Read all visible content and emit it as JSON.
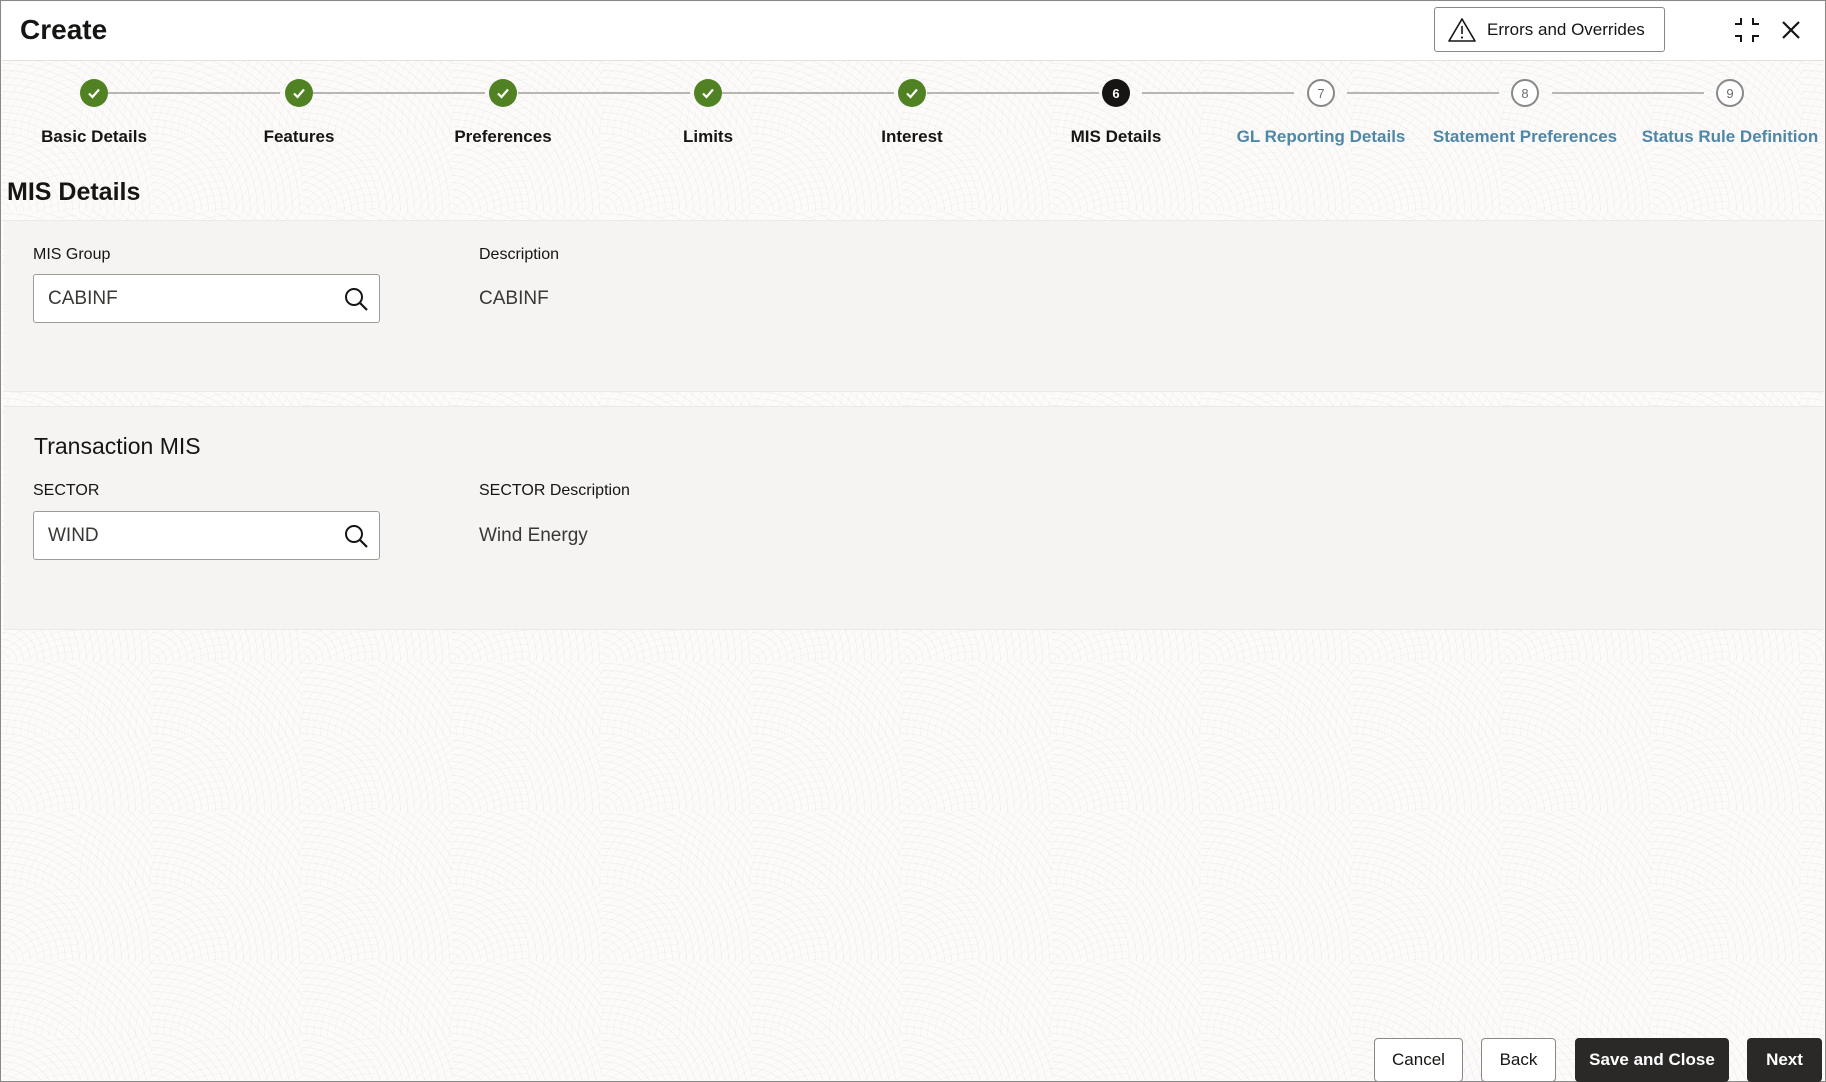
{
  "header": {
    "title": "Create",
    "errors_button": "Errors and Overrides",
    "icons": {
      "minimize": "collapse-icon",
      "close": "close-icon",
      "warning": "warning-icon"
    }
  },
  "train": {
    "stops": [
      {
        "label": "Basic Details",
        "status": "complete",
        "number": ""
      },
      {
        "label": "Features",
        "status": "complete",
        "number": ""
      },
      {
        "label": "Preferences",
        "status": "complete",
        "number": ""
      },
      {
        "label": "Limits",
        "status": "complete",
        "number": ""
      },
      {
        "label": "Interest",
        "status": "complete",
        "number": ""
      },
      {
        "label": "MIS Details",
        "status": "current",
        "number": "6"
      },
      {
        "label": "GL Reporting Details",
        "status": "pending",
        "number": "7"
      },
      {
        "label": "Statement Preferences",
        "status": "pending",
        "number": "8"
      },
      {
        "label": "Status Rule Definition",
        "status": "pending",
        "number": "9"
      }
    ]
  },
  "main": {
    "page_title": "MIS Details",
    "mis_group": {
      "label": "MIS Group",
      "value": "CABINF",
      "description_label": "Description",
      "description_value": "CABINF"
    },
    "transaction_mis": {
      "title": "Transaction MIS",
      "sector_label": "SECTOR",
      "sector_value": "WIND",
      "sector_desc_label": "SECTOR Description",
      "sector_desc_value": "Wind Energy"
    }
  },
  "footer": {
    "cancel": "Cancel",
    "back": "Back",
    "save_close": "Save and Close",
    "next": "Next"
  },
  "colors": {
    "complete": "#508223",
    "current": "#161513",
    "pending_text": "#4e87a7",
    "primary_button": "#2b2927"
  }
}
